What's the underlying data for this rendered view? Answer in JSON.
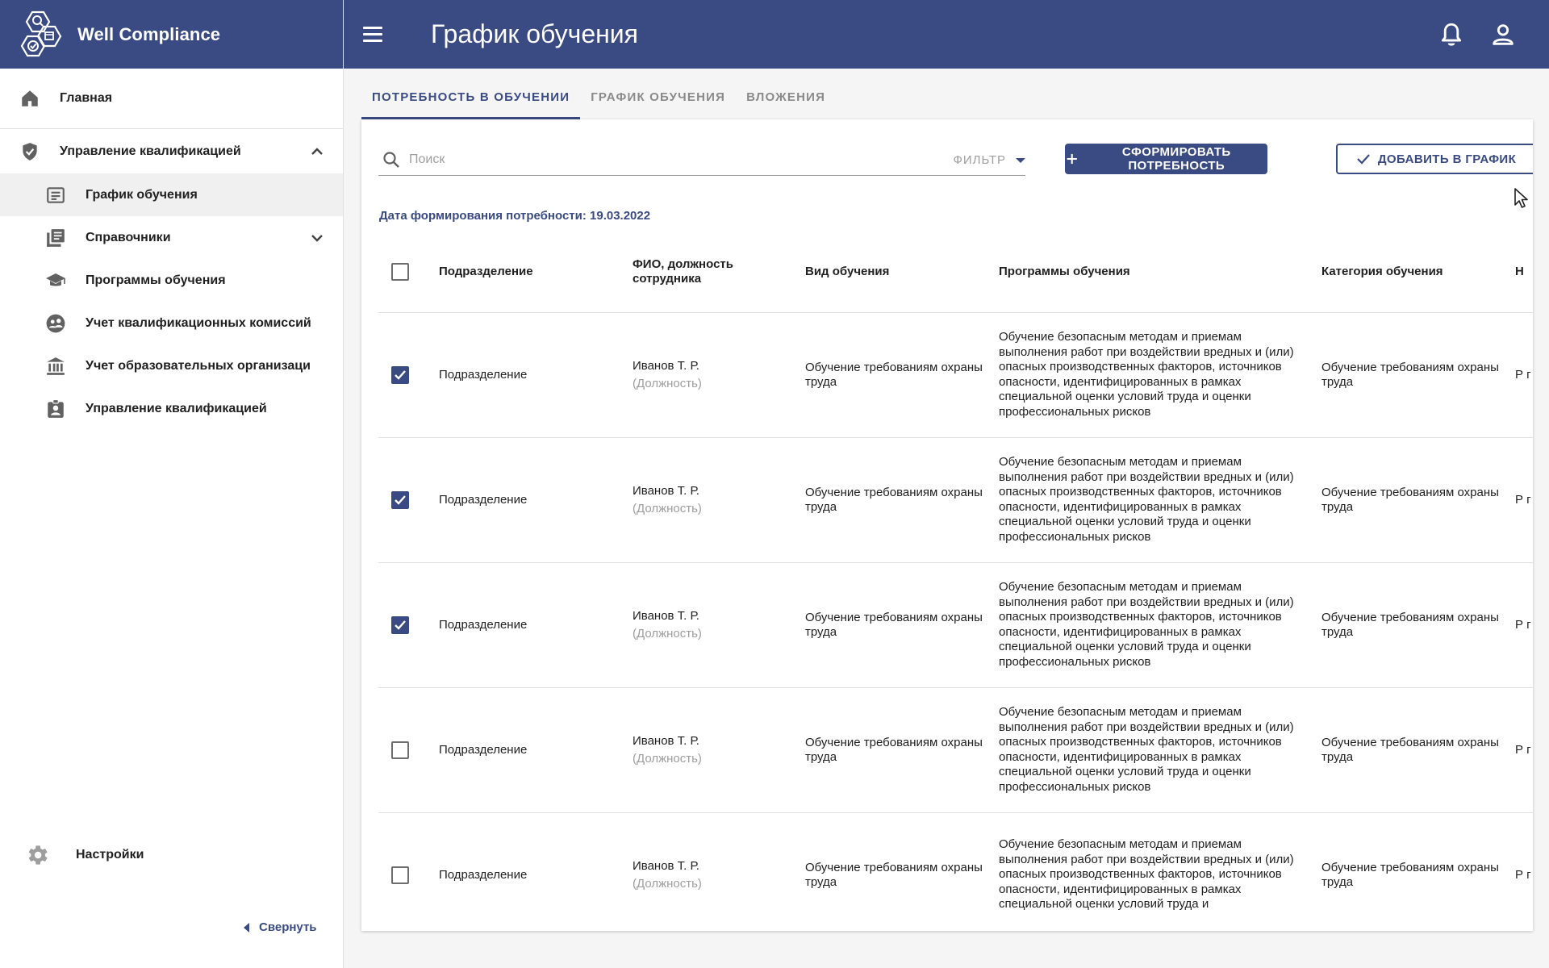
{
  "brand": {
    "name": "Well Compliance"
  },
  "header": {
    "title": "График обучения"
  },
  "sidebar": {
    "items": [
      {
        "label": "Главная",
        "icon": "home-icon"
      },
      {
        "label": "Управление квалификацией",
        "icon": "shield-check-icon"
      },
      {
        "label": "График обучения",
        "icon": "schedule-icon"
      },
      {
        "label": "Справочники",
        "icon": "library-books-icon"
      },
      {
        "label": "Программы обучения",
        "icon": "graduation-cap-icon"
      },
      {
        "label": "Учет квалификационных комиссий",
        "icon": "group-icon"
      },
      {
        "label": "Учет образовательных организаци",
        "icon": "institution-icon"
      },
      {
        "label": "Управление квалификацией",
        "icon": "badge-icon"
      }
    ],
    "settings": "Настройки",
    "collapse": "Свернуть"
  },
  "tabs": [
    {
      "label": "ПОТРЕБНОСТЬ В ОБУЧЕНИИ",
      "active": true
    },
    {
      "label": "ГРАФИК ОБУЧЕНИЯ",
      "active": false
    },
    {
      "label": "ВЛОЖЕНИЯ",
      "active": false
    }
  ],
  "toolbar": {
    "search_placeholder": "Поиск",
    "filter": "ФИЛЬТР",
    "form_button": "СФОРМИРОВАТЬ ПОТРЕБНОСТЬ",
    "add_button": "ДОБАВИТЬ В ГРАФИК"
  },
  "date_line": "Дата формирования потребности: 19.03.2022",
  "table": {
    "headers": [
      "Подразделение",
      "ФИО, должность сотрудника",
      "Вид обучения",
      "Программы обучения",
      "Категория обучения",
      "Н"
    ],
    "rows": [
      {
        "checked": true,
        "division": "Подразделение",
        "name": "Иванов Т. Р.",
        "position": "(Должность)",
        "type": "Обучение требованиям охраны труда",
        "program": "Обучение безопасным методам и приемам выполнения работ при воздействии вредных и (или) опасных производственных факторов, источников опасности, идентифицированных в рамках специальной оценки условий труда и оценки профессиональных рисков",
        "category": "Обучение требованиям охраны труда",
        "more": "Р г"
      },
      {
        "checked": true,
        "division": "Подразделение",
        "name": "Иванов Т. Р.",
        "position": "(Должность)",
        "type": "Обучение требованиям охраны труда",
        "program": "Обучение безопасным методам и приемам выполнения работ при воздействии вредных и (или) опасных производственных факторов, источников опасности, идентифицированных в рамках специальной оценки условий труда и оценки профессиональных рисков",
        "category": "Обучение требованиям охраны труда",
        "more": "Р г"
      },
      {
        "checked": true,
        "division": "Подразделение",
        "name": "Иванов Т. Р.",
        "position": "(Должность)",
        "type": "Обучение требованиям охраны труда",
        "program": "Обучение безопасным методам и приемам выполнения работ при воздействии вредных и (или) опасных производственных факторов, источников опасности, идентифицированных в рамках специальной оценки условий труда и оценки профессиональных рисков",
        "category": "Обучение требованиям охраны труда",
        "more": "Р г"
      },
      {
        "checked": false,
        "division": "Подразделение",
        "name": "Иванов Т. Р.",
        "position": "(Должность)",
        "type": "Обучение требованиям охраны труда",
        "program": "Обучение безопасным методам и приемам выполнения работ при воздействии вредных и (или) опасных производственных факторов, источников опасности, идентифицированных в рамках специальной оценки условий труда и оценки профессиональных рисков",
        "category": "Обучение требованиям охраны труда",
        "more": "Р г"
      },
      {
        "checked": false,
        "division": "Подразделение",
        "name": "Иванов Т. Р.",
        "position": "(Должность)",
        "type": "Обучение требованиям охраны труда",
        "program": "Обучение безопасным методам и приемам выполнения работ при воздействии вредных и (или) опасных производственных факторов, источников опасности, идентифицированных в рамках специальной оценки условий труда и",
        "category": "Обучение требованиям охраны труда",
        "more": "Р г"
      }
    ]
  },
  "colors": {
    "primary": "#3a4a82",
    "muted": "#9e9e9e",
    "active_bg": "#f0f0f0"
  }
}
